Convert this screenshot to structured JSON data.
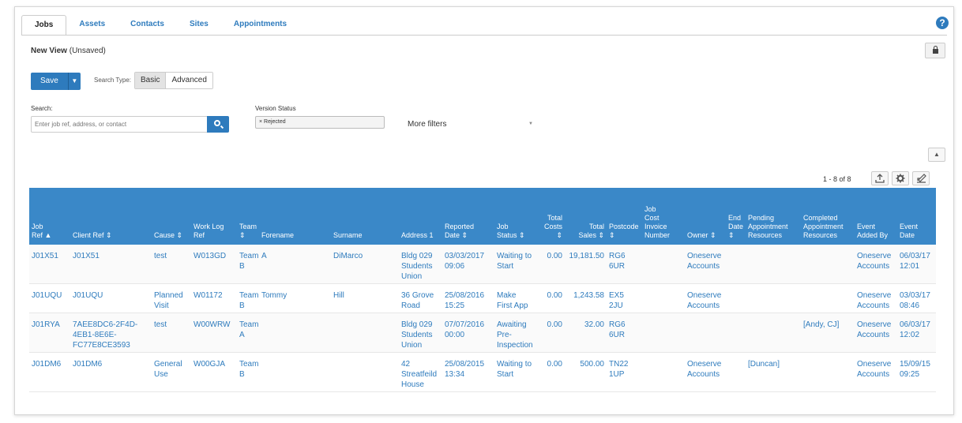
{
  "tabs": [
    "Jobs",
    "Assets",
    "Contacts",
    "Sites",
    "Appointments"
  ],
  "help_glyph": "?",
  "view": {
    "title": "New View",
    "status": "(Unsaved)"
  },
  "toolbar": {
    "save_label": "Save",
    "save_caret": "▼",
    "search_type_label": "Search Type:",
    "basic_label": "Basic",
    "advanced_label": "Advanced"
  },
  "search": {
    "label": "Search:",
    "placeholder": "Enter job ref, address, or contact"
  },
  "version_status": {
    "label": "Version Status",
    "value": "× Rejected"
  },
  "more_filters": {
    "label": "More filters",
    "caret": "▼"
  },
  "collapse_glyph": "▲",
  "pager": {
    "text": "1 - 8 of 8"
  },
  "icons": {
    "lock": "lock-icon",
    "search": "search-icon",
    "export": "export-icon",
    "settings": "gear-icon",
    "edit": "edit-icon"
  },
  "table": {
    "columns": [
      {
        "lines": [
          "Job",
          "Ref ▲"
        ]
      },
      {
        "lines": [
          "Client Ref ⇕"
        ]
      },
      {
        "lines": [
          "Cause ⇕"
        ]
      },
      {
        "lines": [
          "Work Log",
          "Ref"
        ]
      },
      {
        "lines": [
          "Team ⇕"
        ]
      },
      {
        "lines": [
          "Forename"
        ]
      },
      {
        "lines": [
          "Surname"
        ]
      },
      {
        "lines": [
          "Address 1"
        ]
      },
      {
        "lines": [
          "Reported",
          "Date ⇕"
        ]
      },
      {
        "lines": [
          "Job",
          "Status ⇕"
        ]
      },
      {
        "lines": [
          "Total",
          "Costs ⇕"
        ]
      },
      {
        "lines": [
          "Total",
          "Sales ⇕"
        ]
      },
      {
        "lines": [
          "Postcode ⇕"
        ]
      },
      {
        "lines": [
          "Job",
          "Cost",
          "Invoice",
          "Number"
        ]
      },
      {
        "lines": [
          "Owner ⇕"
        ]
      },
      {
        "lines": [
          "End",
          "Date ⇕"
        ]
      },
      {
        "lines": [
          "Pending",
          "Appointment",
          "Resources"
        ]
      },
      {
        "lines": [
          "Completed",
          "Appointment",
          "Resources"
        ]
      },
      {
        "lines": [
          "Event",
          "Added By"
        ]
      },
      {
        "lines": [
          "Event",
          "Date"
        ]
      }
    ],
    "rows": [
      [
        [
          "J01X51"
        ],
        [
          "J01X51"
        ],
        [
          "test"
        ],
        [
          "W013GD"
        ],
        [
          "Team",
          "B"
        ],
        [
          "A"
        ],
        [
          "DiMarco"
        ],
        [
          "Bldg 029",
          "Students",
          "Union"
        ],
        [
          "03/03/2017",
          "09:06"
        ],
        [
          "Waiting to",
          "Start"
        ],
        [
          "0.00"
        ],
        [
          "19,181.50"
        ],
        [
          "RG6",
          "6UR"
        ],
        [],
        [
          "Oneserve",
          "Accounts"
        ],
        [],
        [],
        [],
        [
          "Oneserve",
          "Accounts"
        ],
        [
          "06/03/17",
          "12:01"
        ]
      ],
      [
        [
          "J01UQU"
        ],
        [
          "J01UQU"
        ],
        [
          "Planned",
          "Visit"
        ],
        [
          "W01172"
        ],
        [
          "Team",
          "B"
        ],
        [
          "Tommy"
        ],
        [
          "Hill"
        ],
        [
          "36 Grove",
          "Road"
        ],
        [
          "25/08/2016",
          "15:25"
        ],
        [
          "Make",
          "First App"
        ],
        [
          "0.00"
        ],
        [
          "1,243.58"
        ],
        [
          "EX5 2JU"
        ],
        [],
        [
          "Oneserve",
          "Accounts"
        ],
        [],
        [],
        [],
        [
          "Oneserve",
          "Accounts"
        ],
        [
          "03/03/17",
          "08:46"
        ]
      ],
      [
        [
          "J01RYA"
        ],
        [
          "7AEE8DC6-2F4D-",
          "4EB1-8E6E-",
          "FC77E8CE3593"
        ],
        [
          "test"
        ],
        [
          "W00WRW"
        ],
        [
          "Team",
          "A"
        ],
        [],
        [],
        [
          "Bldg 029",
          "Students",
          "Union"
        ],
        [
          "07/07/2016",
          "00:00"
        ],
        [
          "Awaiting",
          "Pre-",
          "Inspection"
        ],
        [
          "0.00"
        ],
        [
          "32.00"
        ],
        [
          "RG6",
          "6UR"
        ],
        [],
        [],
        [],
        [],
        [
          "[Andy, CJ]"
        ],
        [
          "Oneserve",
          "Accounts"
        ],
        [
          "06/03/17",
          "12:02"
        ]
      ],
      [
        [
          "J01DM6"
        ],
        [
          "J01DM6"
        ],
        [
          "General",
          "Use"
        ],
        [
          "W00GJA"
        ],
        [
          "Team",
          "B"
        ],
        [],
        [],
        [
          "42",
          "Streatfeild",
          "House"
        ],
        [
          "25/08/2015",
          "13:34"
        ],
        [
          "Waiting to",
          "Start"
        ],
        [
          "0.00"
        ],
        [
          "500.00"
        ],
        [
          "TN22",
          "1UP"
        ],
        [],
        [
          "Oneserve",
          "Accounts"
        ],
        [],
        [
          "[Duncan]"
        ],
        [],
        [
          "Oneserve",
          "Accounts"
        ],
        [
          "15/09/15",
          "09:25"
        ]
      ]
    ]
  }
}
